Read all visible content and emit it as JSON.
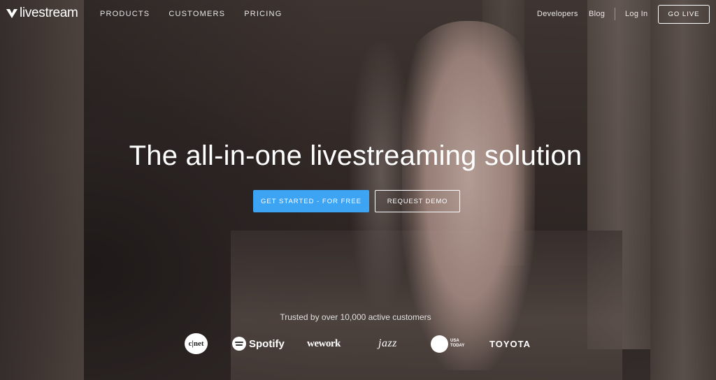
{
  "brand": {
    "logo_text": "livestream"
  },
  "nav": {
    "left": [
      {
        "label": "PRODUCTS"
      },
      {
        "label": "CUSTOMERS"
      },
      {
        "label": "PRICING"
      }
    ],
    "developers": "Developers",
    "blog": "Blog",
    "login": "Log In",
    "go_live": "GO LIVE"
  },
  "hero": {
    "headline": "The all-in-one livestreaming solution",
    "cta_primary": "GET STARTED - FOR FREE",
    "cta_secondary": "REQUEST DEMO",
    "trusted": "Trusted by over 10,000 active customers"
  },
  "customer_logos": {
    "cnet": "c|net",
    "spotify": "Spotify",
    "wework": "wework",
    "jazz": "jazz",
    "usatoday": "USA TODAY",
    "toyota": "TOYOTA"
  },
  "colors": {
    "accent": "#3da4f4",
    "text": "#ffffff"
  }
}
